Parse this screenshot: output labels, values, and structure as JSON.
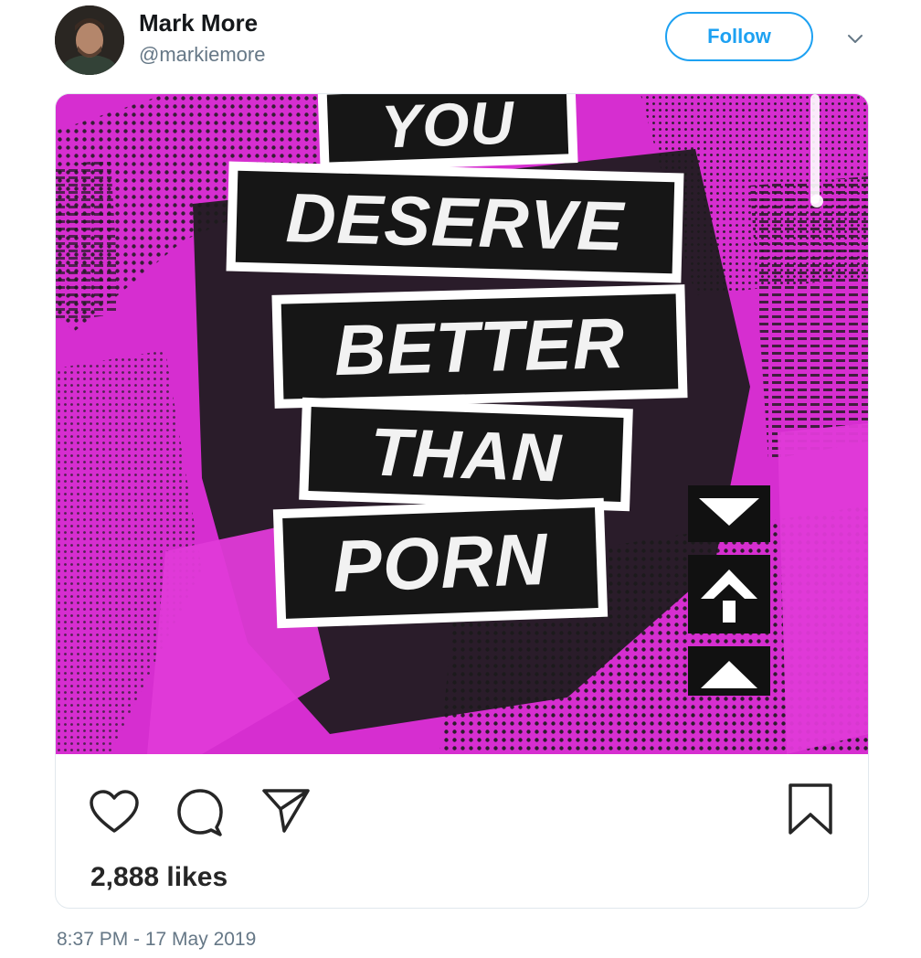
{
  "tweet": {
    "author": {
      "display_name": "Mark More",
      "handle": "@markiemore"
    },
    "follow_label": "Follow",
    "timestamp": "8:37 PM - 17 May 2019"
  },
  "embed": {
    "image_text": {
      "line1": "YOU",
      "line2": "DESERVE",
      "line3": "BETTER",
      "line4": "THAN",
      "line5": "PORN"
    },
    "likes": "2,888 likes",
    "icons": [
      "heart-icon",
      "comment-icon",
      "share-icon",
      "bookmark-icon"
    ]
  },
  "colors": {
    "accent": "#1da1f2",
    "poster_pink": "#d62ed0",
    "poster_black": "#161616",
    "muted_text": "#657786"
  }
}
